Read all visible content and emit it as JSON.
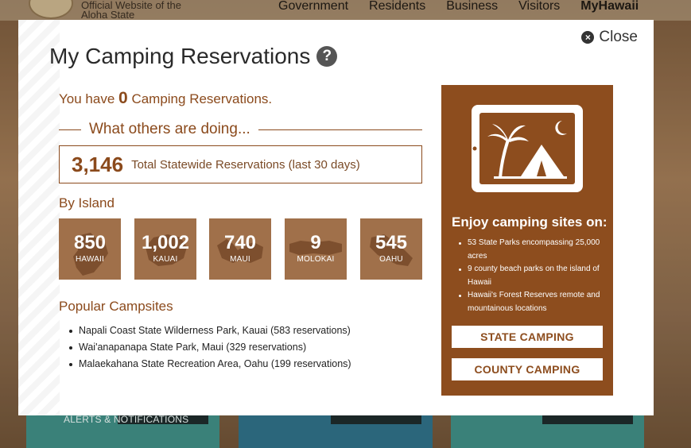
{
  "site": {
    "tagline": "Official Website of the Aloha State",
    "nav": [
      "Government",
      "Residents",
      "Business",
      "Visitors",
      "MyHawaii"
    ],
    "tiles": {
      "alerts_label": "ALERTS & NOTIFICATIONS"
    }
  },
  "modal": {
    "close_label": "Close",
    "title": "My Camping Reservations",
    "help_glyph": "?",
    "reservations_prefix": "You have",
    "reservations_count": "0",
    "reservations_suffix": "Camping Reservations.",
    "others_heading": "What others are doing...",
    "total_count": "3,146",
    "total_label": "Total Statewide Reservations (last 30 days)",
    "by_island_heading": "By Island",
    "islands": [
      {
        "count": "850",
        "name": "HAWAII"
      },
      {
        "count": "1,002",
        "name": "KAUAI"
      },
      {
        "count": "740",
        "name": "MAUI"
      },
      {
        "count": "9",
        "name": "MOLOKAI"
      },
      {
        "count": "545",
        "name": "OAHU"
      }
    ],
    "popular_heading": "Popular Campsites",
    "campsites": [
      "Napali Coast State Wilderness Park, Kauai (583 reservations)",
      "Wai'anapanapa State Park, Maui (329 reservations)",
      "Malaekahana State Recreation Area, Oahu (199 reservations)"
    ]
  },
  "promo": {
    "icon": "palm-tent-tablet-icon",
    "heading": "Enjoy camping sites on:",
    "items": [
      "53 State Parks encompassing 25,000 acres",
      "9 county beach parks on the island of Hawaii",
      "Hawaii's Forest Reserves remote and mountainous locations"
    ],
    "state_button": "STATE CAMPING",
    "county_button": "COUNTY CAMPING"
  },
  "colors": {
    "brand_brown": "#8b4a1c",
    "promo_brown": "#8d4d1e",
    "island_tile": "#a0704a",
    "tile_teal": "#3f8d84"
  }
}
